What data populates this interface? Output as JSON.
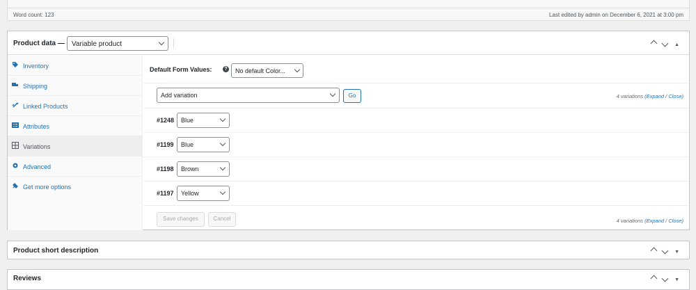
{
  "editor_status": {
    "word_count": "Word count: 123",
    "last_edited": "Last edited by admin on December 6, 2021 at 3:00 pm"
  },
  "product_data": {
    "title": "Product data —",
    "type_value": "Variable product",
    "tabs": [
      {
        "label": "Inventory",
        "icon": "tag-icon"
      },
      {
        "label": "Shipping",
        "icon": "truck-icon"
      },
      {
        "label": "Linked Products",
        "icon": "link-icon"
      },
      {
        "label": "Attributes",
        "icon": "list-icon"
      },
      {
        "label": "Variations",
        "icon": "grid-icon"
      },
      {
        "label": "Advanced",
        "icon": "gear-icon"
      },
      {
        "label": "Get more options",
        "icon": "plugin-icon"
      }
    ],
    "default_form_label": "Default Form Values:",
    "default_form_value": "No default Color...",
    "add_variation_value": "Add variation",
    "go_label": "Go",
    "variations_count": "4 variations",
    "expand_label": "(Expand",
    "close_label": "Close)",
    "variations": [
      {
        "id": "#1248",
        "color": "Blue"
      },
      {
        "id": "#1199",
        "color": "Blue"
      },
      {
        "id": "#1198",
        "color": "Brown"
      },
      {
        "id": "#1197",
        "color": "Yellow"
      }
    ],
    "save_label": "Save changes",
    "cancel_label": "Cancel"
  },
  "short_description": {
    "title": "Product short description"
  },
  "reviews": {
    "title": "Reviews"
  }
}
